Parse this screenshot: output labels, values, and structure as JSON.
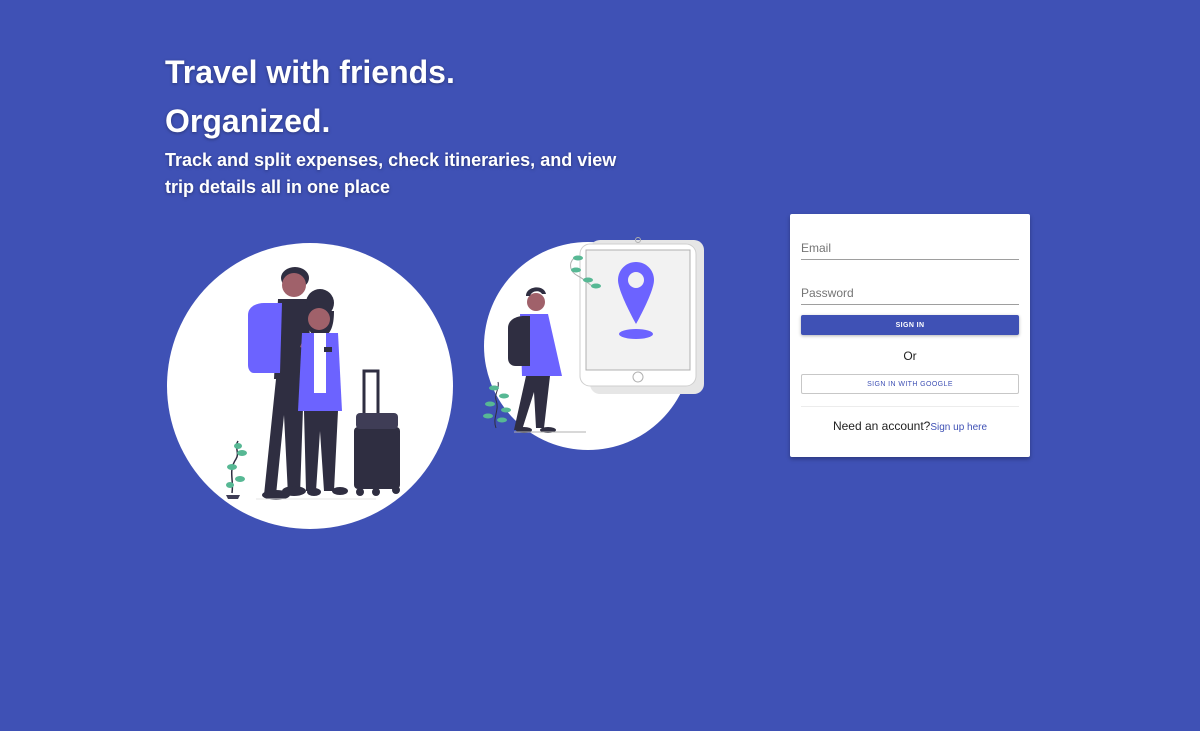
{
  "hero": {
    "title_line1": "Travel with friends.",
    "title_line2": "Organized.",
    "subtitle": "Track and split expenses, check itineraries, and view trip details all in one place"
  },
  "login": {
    "email_placeholder": "Email",
    "password_placeholder": "Password",
    "signin_label": "SIGN IN",
    "or_label": "Or",
    "google_label": "SIGN IN WITH GOOGLE",
    "need_account_text": "Need an account?",
    "signup_link_text": "Sign up here"
  },
  "colors": {
    "background": "#3f51b5",
    "accent_purple": "#6c63ff",
    "dark_figure": "#2f2e41",
    "plant_green": "#57b894"
  }
}
